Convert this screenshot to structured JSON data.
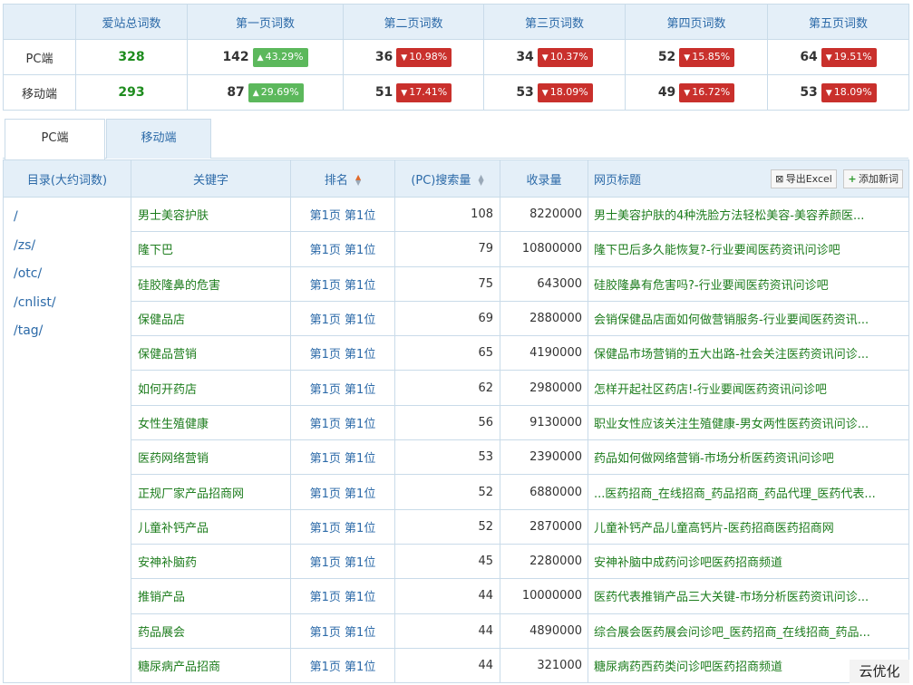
{
  "summary": {
    "headers": [
      "",
      "爱站总词数",
      "第一页词数",
      "第二页词数",
      "第三页词数",
      "第四页词数",
      "第五页词数"
    ],
    "rows": [
      {
        "label": "PC端",
        "total": "328",
        "pages": [
          {
            "count": "142",
            "change": "43.29%",
            "dir": "up"
          },
          {
            "count": "36",
            "change": "10.98%",
            "dir": "down"
          },
          {
            "count": "34",
            "change": "10.37%",
            "dir": "down"
          },
          {
            "count": "52",
            "change": "15.85%",
            "dir": "down"
          },
          {
            "count": "64",
            "change": "19.51%",
            "dir": "down"
          }
        ]
      },
      {
        "label": "移动端",
        "total": "293",
        "pages": [
          {
            "count": "87",
            "change": "29.69%",
            "dir": "up"
          },
          {
            "count": "51",
            "change": "17.41%",
            "dir": "down"
          },
          {
            "count": "53",
            "change": "18.09%",
            "dir": "down"
          },
          {
            "count": "49",
            "change": "16.72%",
            "dir": "down"
          },
          {
            "count": "53",
            "change": "18.09%",
            "dir": "down"
          }
        ]
      }
    ]
  },
  "tabs": [
    {
      "label": "PC端",
      "active": true
    },
    {
      "label": "移动端",
      "active": false
    }
  ],
  "main": {
    "headers": {
      "dir": "目录(大约词数)",
      "keyword": "关键字",
      "rank": "排名",
      "volume": "(PC)搜索量",
      "indexed": "收录量",
      "title": "网页标题"
    },
    "buttons": {
      "export": "导出Excel",
      "add": "添加新词"
    },
    "dirs": [
      "/",
      "/zs/",
      "/otc/",
      "/cnlist/",
      "/tag/"
    ],
    "rows": [
      {
        "keyword": "男士美容护肤",
        "rank": "第1页 第1位",
        "volume": "108",
        "indexed": "8220000",
        "title": "男士美容护肤的4种洗脸方法轻松美容-美容养颜医..."
      },
      {
        "keyword": "隆下巴",
        "rank": "第1页 第1位",
        "volume": "79",
        "indexed": "10800000",
        "title": "隆下巴后多久能恢复?-行业要闻医药资讯问诊吧"
      },
      {
        "keyword": "硅胶隆鼻的危害",
        "rank": "第1页 第1位",
        "volume": "75",
        "indexed": "643000",
        "title": "硅胶隆鼻有危害吗?-行业要闻医药资讯问诊吧"
      },
      {
        "keyword": "保健品店",
        "rank": "第1页 第1位",
        "volume": "69",
        "indexed": "2880000",
        "title": "会销保健品店面如何做营销服务-行业要闻医药资讯..."
      },
      {
        "keyword": "保健品营销",
        "rank": "第1页 第1位",
        "volume": "65",
        "indexed": "4190000",
        "title": "保健品市场营销的五大出路-社会关注医药资讯问诊..."
      },
      {
        "keyword": "如何开药店",
        "rank": "第1页 第1位",
        "volume": "62",
        "indexed": "2980000",
        "title": "怎样开起社区药店!-行业要闻医药资讯问诊吧"
      },
      {
        "keyword": "女性生殖健康",
        "rank": "第1页 第1位",
        "volume": "56",
        "indexed": "9130000",
        "title": "职业女性应该关注生殖健康-男女两性医药资讯问诊..."
      },
      {
        "keyword": "医药网络营销",
        "rank": "第1页 第1位",
        "volume": "53",
        "indexed": "2390000",
        "title": "药品如何做网络营销-市场分析医药资讯问诊吧"
      },
      {
        "keyword": "正规厂家产品招商网",
        "rank": "第1页 第1位",
        "volume": "52",
        "indexed": "6880000",
        "title": "...医药招商_在线招商_药品招商_药品代理_医药代表..."
      },
      {
        "keyword": "儿童补钙产品",
        "rank": "第1页 第1位",
        "volume": "52",
        "indexed": "2870000",
        "title": "儿童补钙产品儿童高钙片-医药招商医药招商网"
      },
      {
        "keyword": "安神补脑药",
        "rank": "第1页 第1位",
        "volume": "45",
        "indexed": "2280000",
        "title": "安神补脑中成药问诊吧医药招商频道"
      },
      {
        "keyword": "推销产品",
        "rank": "第1页 第1位",
        "volume": "44",
        "indexed": "10000000",
        "title": "医药代表推销产品三大关键-市场分析医药资讯问诊..."
      },
      {
        "keyword": "药品展会",
        "rank": "第1页 第1位",
        "volume": "44",
        "indexed": "4890000",
        "title": "综合展会医药展会问诊吧_医药招商_在线招商_药品..."
      },
      {
        "keyword": "糖尿病产品招商",
        "rank": "第1页 第1位",
        "volume": "44",
        "indexed": "321000",
        "title": "糖尿病药西药类问诊吧医药招商频道"
      }
    ]
  },
  "watermark": "云优化"
}
